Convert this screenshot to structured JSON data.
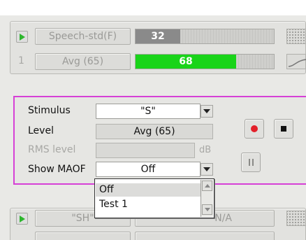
{
  "top_panel": {
    "row1": {
      "preset": "Speech-std(F)",
      "meter_value": "32"
    },
    "row2": {
      "index": "1",
      "preset": "Avg (65)",
      "meter_value": "68"
    }
  },
  "stimulus_panel": {
    "stimulus": {
      "label": "Stimulus",
      "value": "\"S\""
    },
    "level": {
      "label": "Level",
      "value": "Avg (65)"
    },
    "rms_level": {
      "label": "RMS level",
      "value": "",
      "unit": "dB"
    },
    "show_maof": {
      "label": "Show MAOF",
      "value": "Off"
    },
    "dropdown": {
      "options": [
        "Off",
        "Test 1"
      ],
      "selected": "Off"
    }
  },
  "bottom_panel": {
    "row1": {
      "preset": "\"SH\"",
      "status": "N/A"
    }
  },
  "colors": {
    "accent_border": "#d640d6",
    "meter_gray": "#8a8a8a",
    "meter_green": "#19d419",
    "record_red": "#e3202a",
    "play_green": "#2db62d"
  },
  "icons": [
    "play-icon",
    "grid-icon",
    "curve-icon",
    "dropdown-arrow-icon",
    "record-icon",
    "stop-icon",
    "pause-icon",
    "scroll-up-icon",
    "scroll-down-icon"
  ]
}
